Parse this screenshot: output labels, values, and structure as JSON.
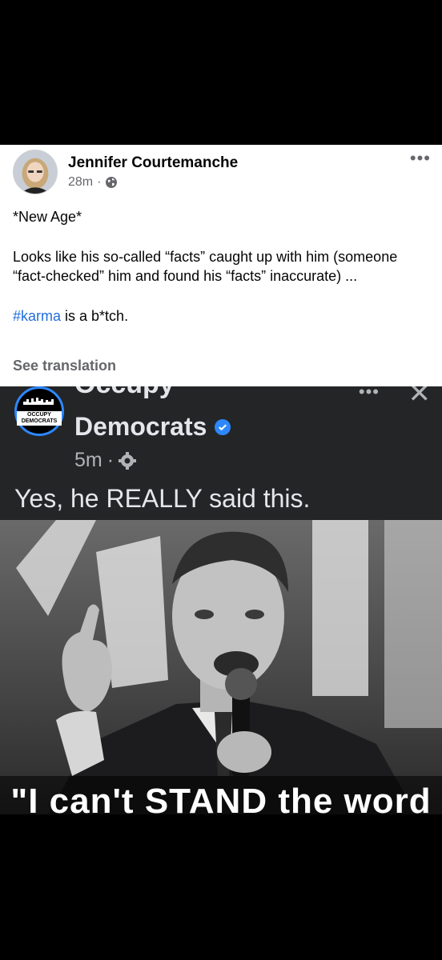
{
  "post": {
    "author": "Jennifer Courtemanche",
    "time": "28m",
    "separator": "·",
    "more_icon": "more-horizontal-icon",
    "text_line1": "*New Age*",
    "text_line2": "Looks like his so-called “facts” caught up with him (someone “fact-checked” him and found his “facts” inaccurate) ...",
    "hashtag": "#karma",
    "text_after_hashtag": " is a b*tch.",
    "see_translation": "See translation",
    "colors": {
      "link": "#216fdb",
      "secondary": "#65676b"
    }
  },
  "shared": {
    "logo_text": "OCCUPY DEMOCRATS",
    "name_top": "Occupy",
    "name": "Democrats",
    "time": "5m",
    "separator": "·",
    "text": "Yes, he REALLY said this.",
    "more_icon": "more-horizontal-icon",
    "close_icon": "close-icon",
    "colors": {
      "background": "#242526",
      "verified": "#2d88ff"
    }
  },
  "meme": {
    "caption": "\"I can't STAND the word"
  }
}
